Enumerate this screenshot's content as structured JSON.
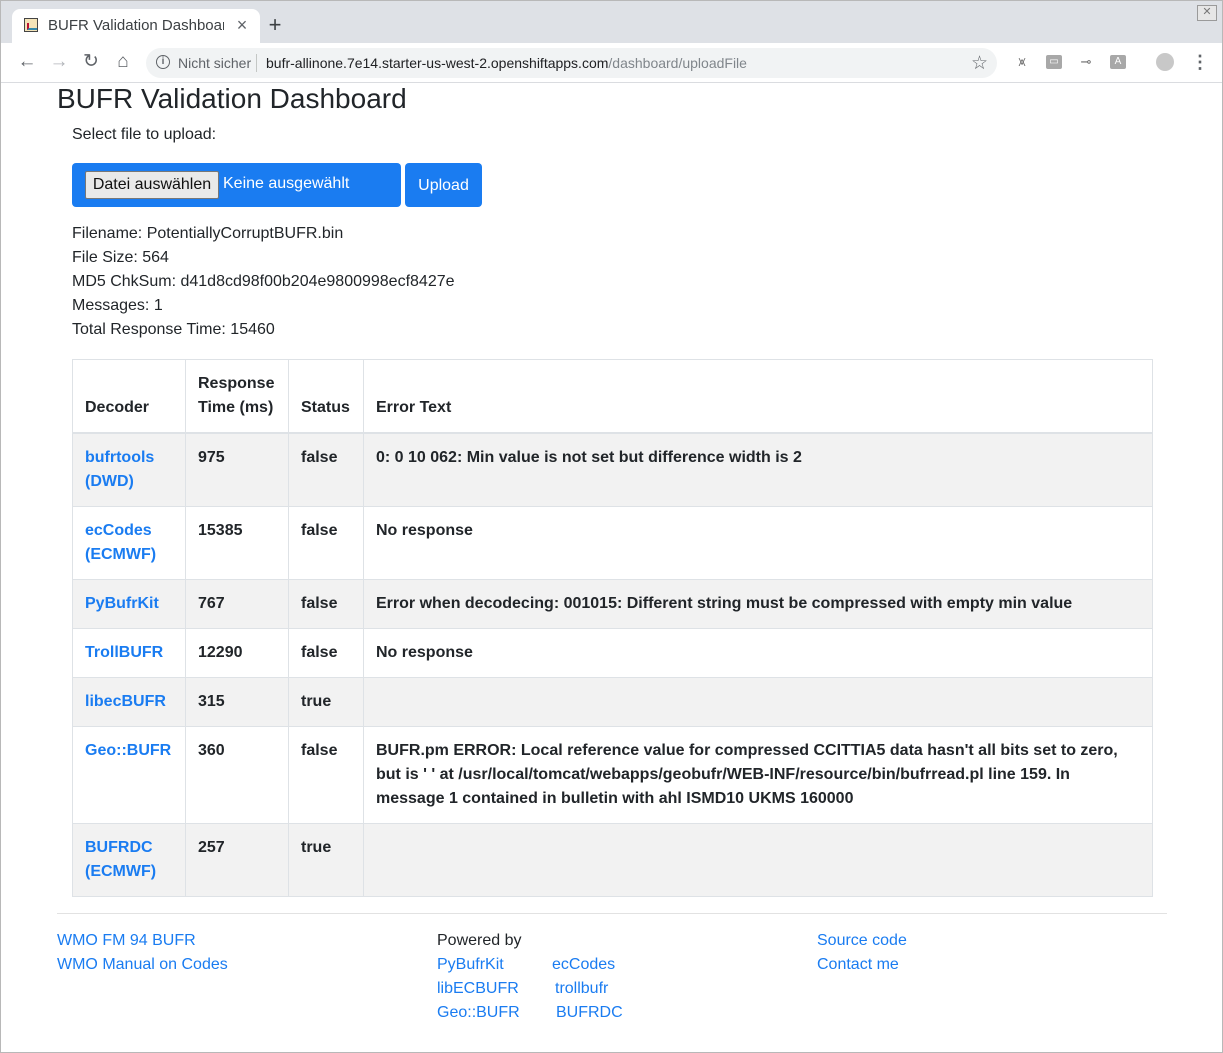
{
  "browser": {
    "tab_title": "BUFR Validation Dashboard",
    "tab_close": "×",
    "new_tab": "+",
    "security_label": "Nicht sicher",
    "url_host": "bufr-allinone.7e14.starter-us-west-2.openshiftapps.com",
    "url_path": "/dashboard/uploadFile"
  },
  "page": {
    "title": "BUFR Validation Dashboard",
    "select_label": "Select file to upload:",
    "choose_file_button": "Datei auswählen",
    "no_file_text": "Keine ausgewählt",
    "upload_button": "Upload"
  },
  "file_info": {
    "filename": "Filename: PotentiallyCorruptBUFR.bin",
    "file_size": "File Size: 564",
    "md5": "MD5 ChkSum: d41d8cd98f00b204e9800998ecf8427e",
    "messages": "Messages: 1",
    "total_time": "Total Response Time: 15460"
  },
  "table": {
    "headers": [
      "Decoder",
      "Response Time (ms)",
      "Status",
      "Error Text"
    ],
    "rows": [
      {
        "decoder": "bufrtools (DWD)",
        "time": "975",
        "status": "false",
        "error": "0: 0 10 062: Min value is not set but difference width is 2"
      },
      {
        "decoder": "ecCodes (ECMWF)",
        "time": "15385",
        "status": "false",
        "error": "No response"
      },
      {
        "decoder": "PyBufrKit",
        "time": "767",
        "status": "false",
        "error": "Error when decodecing: 001015: Different string must be compressed with empty min value"
      },
      {
        "decoder": "TrollBUFR",
        "time": "12290",
        "status": "false",
        "error": "No response"
      },
      {
        "decoder": "libecBUFR",
        "time": "315",
        "status": "true",
        "error": ""
      },
      {
        "decoder": "Geo::BUFR",
        "time": "360",
        "status": "false",
        "error": "BUFR.pm ERROR: Local reference value for compressed CCITTIA5 data hasn't all bits set to zero, but is ' ' at /usr/local/tomcat/webapps/geobufr/WEB-INF/resource/bin/bufrread.pl line 159. In message 1 contained in bulletin with ahl ISMD10 UKMS 160000"
      },
      {
        "decoder": "BUFRDC (ECMWF)",
        "time": "257",
        "status": "true",
        "error": ""
      }
    ]
  },
  "footer": {
    "links_left": [
      "WMO FM 94 BUFR",
      "WMO Manual on Codes"
    ],
    "powered_by": "Powered by",
    "powered_links": [
      "PyBufrKit",
      "ecCodes",
      "libECBUFR",
      "trollbufr",
      "Geo::BUFR",
      "BUFRDC"
    ],
    "links_right": [
      "Source code",
      "Contact me"
    ]
  }
}
